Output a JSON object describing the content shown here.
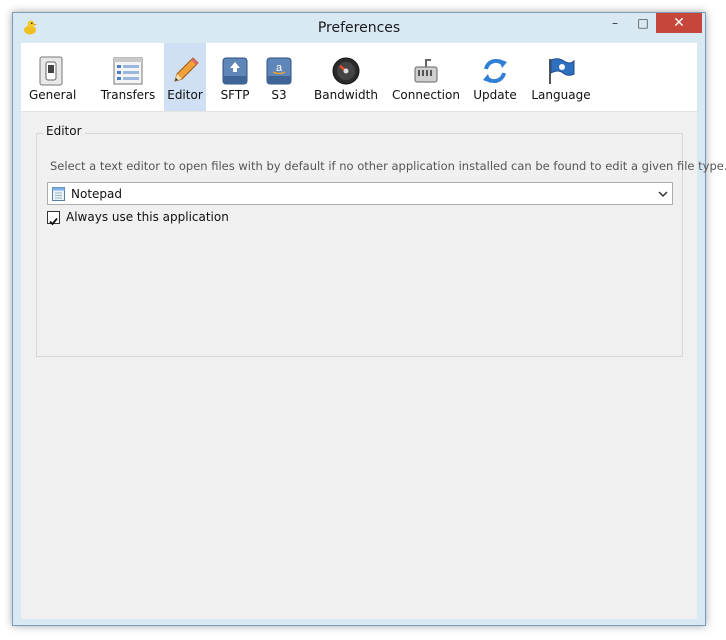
{
  "window": {
    "title": "Preferences",
    "controls": {
      "minimize": "–",
      "maximize": "□",
      "close": "✕"
    }
  },
  "toolbar": {
    "items": [
      {
        "label": "General",
        "icon": "general-switch-icon",
        "active": false
      },
      {
        "label": "Transfers",
        "icon": "transfers-list-icon",
        "active": false
      },
      {
        "label": "Editor",
        "icon": "pencil-icon",
        "active": true
      },
      {
        "label": "SFTP",
        "icon": "sftp-disk-icon",
        "active": false
      },
      {
        "label": "S3",
        "icon": "s3-disk-icon",
        "active": false
      },
      {
        "label": "Bandwidth",
        "icon": "bandwidth-gauge-icon",
        "active": false
      },
      {
        "label": "Connection",
        "icon": "connection-plug-icon",
        "active": false
      },
      {
        "label": "Update",
        "icon": "update-refresh-icon",
        "active": false
      },
      {
        "label": "Language",
        "icon": "language-flag-icon",
        "active": false
      }
    ]
  },
  "editor": {
    "group_title": "Editor",
    "description": "Select a text editor to open files with by default if no other application installed can be found to edit a given file type.",
    "selected_editor": "Notepad",
    "always_use_label": "Always use this application",
    "always_use_checked": true
  },
  "colors": {
    "active_tab": "#cfe0f5",
    "close_button": "#c7463b",
    "frame": "#d9e9f4"
  }
}
